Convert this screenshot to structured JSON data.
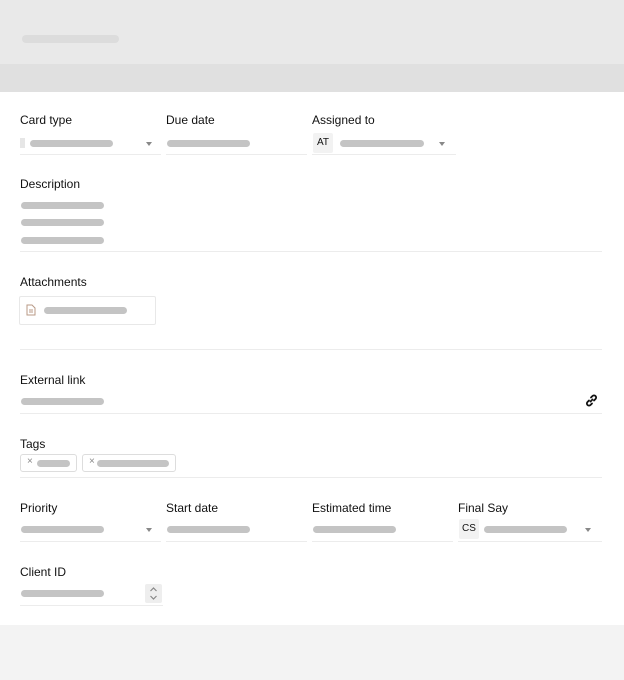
{
  "form": {
    "card_type_label": "Card type",
    "due_date_label": "Due date",
    "assigned_to_label": "Assigned to",
    "assigned_to_initials": "AT",
    "description_label": "Description",
    "attachments_label": "Attachments",
    "external_link_label": "External link",
    "tags_label": "Tags",
    "tag_remove_glyph": "×",
    "priority_label": "Priority",
    "start_date_label": "Start date",
    "estimated_time_label": "Estimated time",
    "final_say_label": "Final Say",
    "final_say_initials": "CS",
    "client_id_label": "Client ID"
  },
  "colors": {
    "header": "#e9e9e9",
    "band": "#e0e0e0",
    "skeleton": "#c4c4c4",
    "card": "#ffffff"
  }
}
